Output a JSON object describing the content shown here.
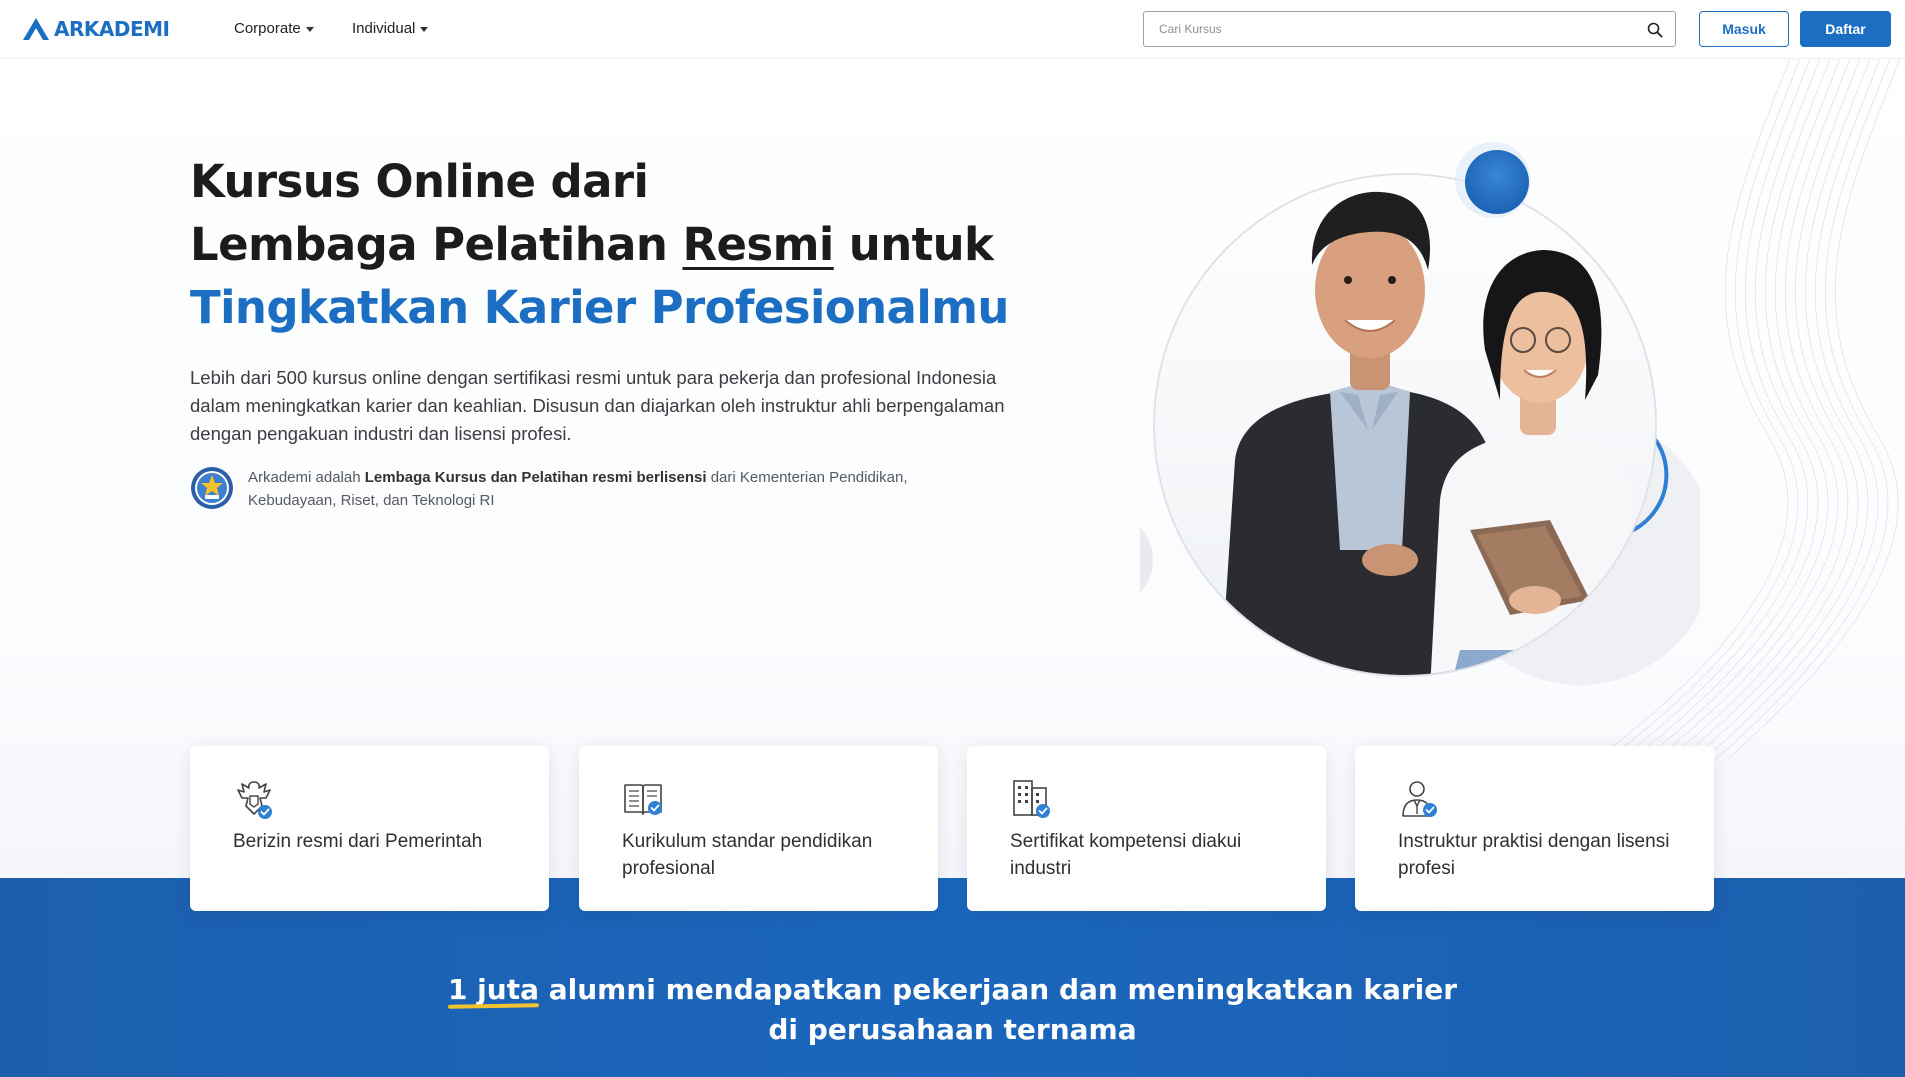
{
  "header": {
    "logo_text": "ARKADEMI",
    "nav": [
      {
        "label": "Corporate"
      },
      {
        "label": "Individual"
      }
    ],
    "search_placeholder": "Cari Kursus",
    "login_label": "Masuk",
    "register_label": "Daftar"
  },
  "hero": {
    "headline_line1": "Kursus Online dari",
    "headline_line2_a": "Lembaga Pelatihan ",
    "headline_line2_b": "Resmi",
    "headline_line2_c": " untuk",
    "headline_line3": "Tingkatkan Karier Profesionalmu",
    "lead": "Lebih dari 500 kursus online dengan sertifikasi resmi untuk para pekerja dan profesional Indonesia dalam meningkatkan karier dan keahlian. Disusun dan diajarkan oleh instruktur ahli berpengalaman dengan pengakuan industri dan lisensi profesi.",
    "license_a": "Arkademi adalah ",
    "license_b": "Lembaga Kursus dan Pelatihan resmi berlisensi",
    "license_c": " dari Kementerian Pendidikan, Kebudayaan, Riset, dan Teknologi RI"
  },
  "features": [
    {
      "text": "Berizin resmi dari Pemerintah",
      "icon": "garuda-icon"
    },
    {
      "text": "Kurikulum standar pendidikan profesional",
      "icon": "book-icon"
    },
    {
      "text": "Sertifikat kompetensi diakui industri",
      "icon": "building-icon"
    },
    {
      "text": "Instruktur praktisi dengan lisensi profesi",
      "icon": "instructor-icon"
    }
  ],
  "alumni": {
    "highlight": "1 juta",
    "line1_rest": " alumni mendapatkan pekerjaan dan meningkatkan karier",
    "line2": "di perusahaan ternama"
  },
  "colors": {
    "brand_blue": "#1b6ec2",
    "band_blue": "#1c5fae",
    "highlight_yellow": "#f2c230"
  }
}
